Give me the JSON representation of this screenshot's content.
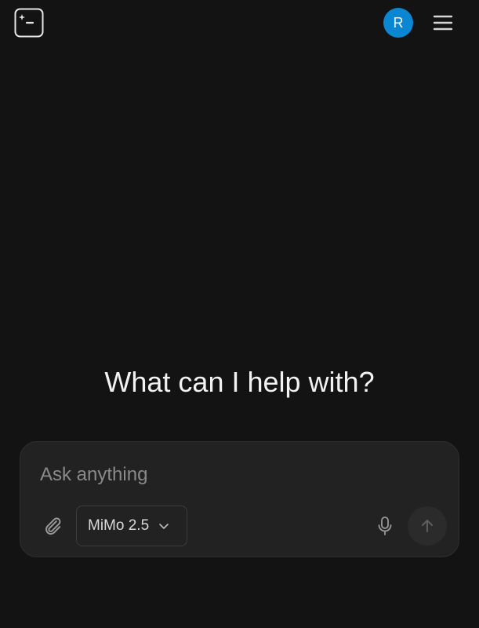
{
  "header": {
    "new_chat_icon": "new-chat-terminal-icon",
    "avatar_initial": "R",
    "avatar_color": "#0a86d2",
    "menu_icon": "hamburger-menu-icon"
  },
  "hero": {
    "title": "What can I help with?"
  },
  "composer": {
    "placeholder": "Ask anything",
    "value": "",
    "attach_icon": "paperclip-icon",
    "model_selector": {
      "selected": "MiMo 2.5",
      "icon": "chevron-down-icon"
    },
    "mic_icon": "microphone-icon",
    "send_icon": "arrow-up-icon"
  },
  "colors": {
    "background": "#131313",
    "composer_bg": "#222222",
    "text_primary": "#f2f2f2",
    "placeholder": "#8a8a8a"
  }
}
